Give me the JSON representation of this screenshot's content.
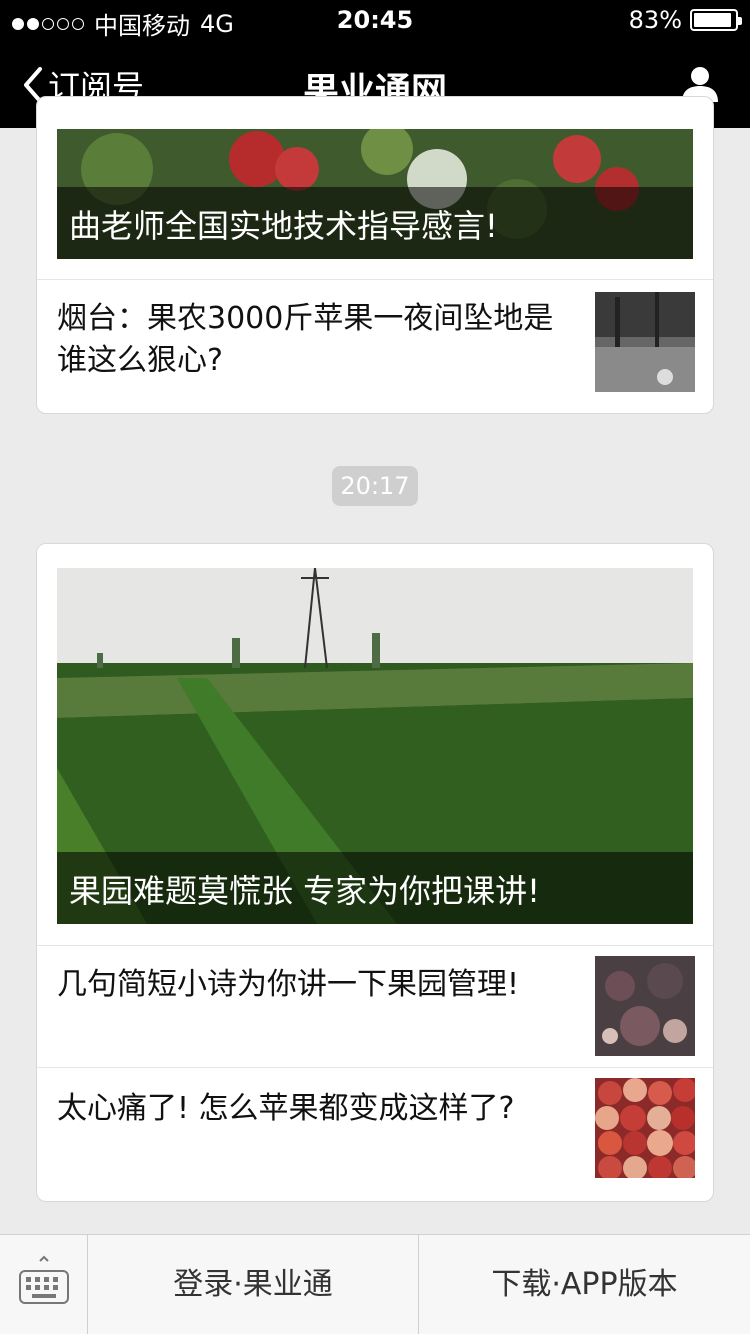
{
  "status": {
    "carrier": "中国移动",
    "network": "4G",
    "time": "20:45",
    "battery": "83%",
    "battery_level": 0.83
  },
  "nav": {
    "back_label": "订阅号",
    "title": "果业通网"
  },
  "feed": {
    "card1": {
      "cover_caption": "曲老师全国实地技术指导感言!",
      "item1": "烟台：果农3000斤苹果一夜间坠地是谁这么狠心?"
    },
    "timestamp": "20:17",
    "card2": {
      "cover_caption": "果园难题莫慌张 专家为你把课讲!",
      "item1": "几句简短小诗为你讲一下果园管理!",
      "item2": "太心痛了! 怎么苹果都变成这样了?"
    }
  },
  "bottom_menu": {
    "login": "登录·果业通",
    "download": "下载·APP版本"
  }
}
